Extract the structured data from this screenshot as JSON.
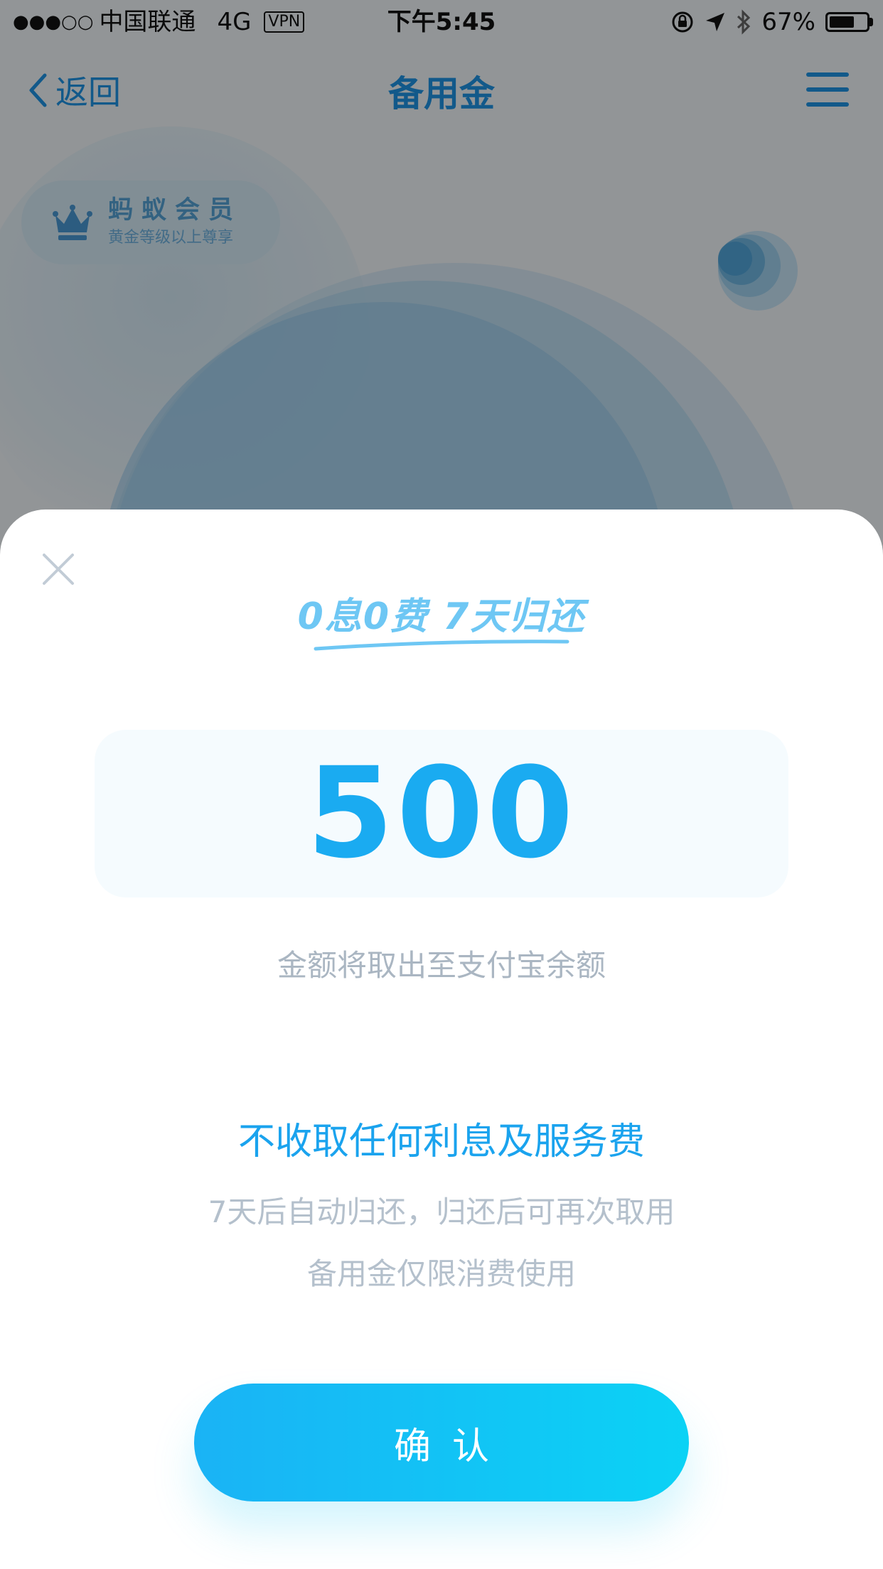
{
  "status_bar": {
    "signal_dots": "●●●○○",
    "carrier": "中国联通",
    "network": "4G",
    "vpn": "VPN",
    "time": "下午5:45",
    "battery_percent": "67%",
    "battery_level": 0.67
  },
  "nav": {
    "back_label": "返回",
    "title": "备用金"
  },
  "background": {
    "member_title": "蚂蚁会员",
    "member_subtitle": "黄金等级以上尊享"
  },
  "modal": {
    "slogan": "0息0费 7天归还",
    "amount": "500",
    "amount_hint": "金额将取出至支付宝余额",
    "feature_title": "不收取任何利息及服务费",
    "description_lines": [
      "7天后自动归还，归还后可再次取用",
      "备用金仅限消费使用"
    ],
    "confirm_label": "确认"
  },
  "colors": {
    "accent": "#1aabf1",
    "button_gradient_start": "#1ab3f5",
    "button_gradient_end": "#0bd2f5",
    "muted_text": "#aab6c2"
  }
}
